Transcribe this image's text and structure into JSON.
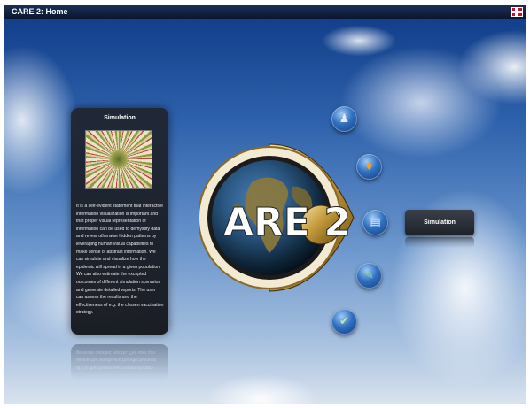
{
  "window": {
    "title": "CARE 2: Home"
  },
  "info_panel": {
    "title": "Simulation",
    "body": "It is a self-evident statement that interactive information visualization is important and that proper visual representation of information can be used to demystify data and reveal otherwise hidden patterns by leveraging human visual capabilities to make sense of abstract information. We can simulate and visualize how the epidemic will spread in a given population. We can also estimate the excepted outcomes of different simulation scenarios and generate detailed reports. The user can assess the results and the effectiveness of e.g. the chosen vaccination strategy.",
    "reflection_text": "of e.g. the chosen vaccination strategy. assess the results and the effectiveness generate detailed reports. The user can"
  },
  "logo": {
    "text": "ARE 2",
    "accent_gold": "#c49a3a",
    "ring_dark": "#2a2a2a"
  },
  "menu": {
    "items": [
      {
        "name": "population",
        "icon": "people-icon"
      },
      {
        "name": "settings",
        "icon": "puzzle-icon"
      },
      {
        "name": "simulation",
        "icon": "clipboard-icon",
        "selected": true
      },
      {
        "name": "edit",
        "icon": "pencil-icon"
      },
      {
        "name": "reports",
        "icon": "checklist-icon"
      }
    ],
    "selected_label": "Simulation"
  },
  "colors": {
    "sky_top": "#0f3a86",
    "panel_bg": "#20242e",
    "button_blue": "#2f6fbf"
  }
}
